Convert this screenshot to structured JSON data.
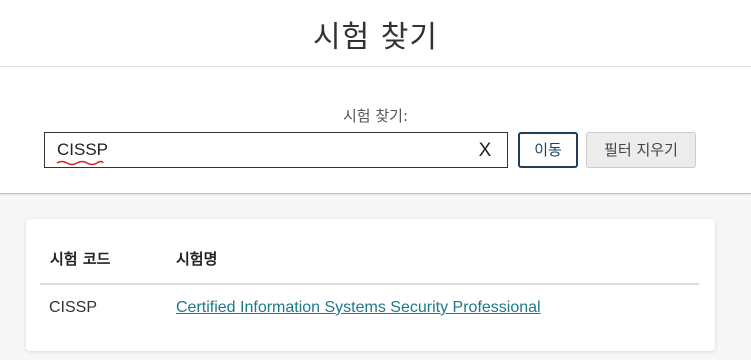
{
  "header": {
    "title": "시험 찾기"
  },
  "search": {
    "label": "시험 찾기:",
    "value": "CISSP",
    "clear_symbol": "X",
    "go_label": "이동",
    "clear_filter_label": "필터 지우기",
    "spellcheck_underline_color": "#d42020"
  },
  "results": {
    "columns": [
      "시험 코드",
      "시험명"
    ],
    "rows": [
      {
        "code": "CISSP",
        "name": "Certified Information Systems Security Professional"
      }
    ],
    "link_color": "#1a7a8c"
  }
}
